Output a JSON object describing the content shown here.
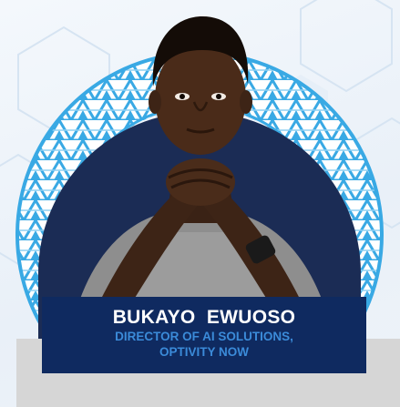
{
  "speaker": {
    "name": "BUKAYO  EWUOSO",
    "role_line1": "DIRECTOR OF AI SOLUTIONS,",
    "role_line2": "OPTIVITY NOW"
  },
  "colors": {
    "plate": "#0f2a60",
    "name_text": "#ffffff",
    "role_text": "#3b8bd9",
    "pattern_blue": "#39a9e4",
    "backdrop": "#eef3f9",
    "base_bar": "#d6d6d6"
  },
  "icons": {
    "portrait": "person-portrait",
    "ring": "african-pattern-ring"
  }
}
